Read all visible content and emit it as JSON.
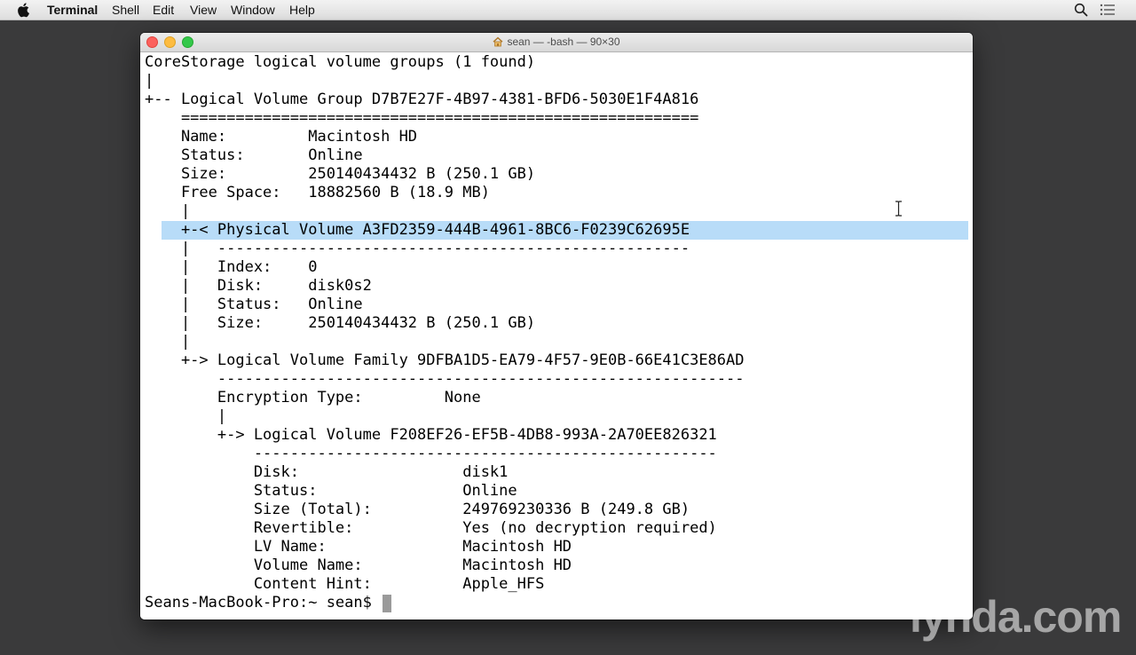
{
  "menubar": {
    "app_name": "Terminal",
    "items": [
      "Shell",
      "Edit",
      "View",
      "Window",
      "Help"
    ],
    "right_icons": [
      "spotlight-search-icon",
      "notification-center-icon"
    ]
  },
  "window": {
    "title": "sean — -bash — 90×30",
    "title_icon": "home-icon"
  },
  "terminal": {
    "lines": [
      "CoreStorage logical volume groups (1 found)",
      "|",
      "+-- Logical Volume Group D7B7E27F-4B97-4381-BFD6-5030E1F4A816",
      "    =========================================================",
      "    Name:         Macintosh HD",
      "    Status:       Online",
      "    Size:         250140434432 B (250.1 GB)",
      "    Free Space:   18882560 B (18.9 MB)",
      "    |",
      "    +-< Physical Volume A3FD2359-444B-4961-8BC6-F0239C62695E",
      "    |   ----------------------------------------------------",
      "    |   Index:    0",
      "    |   Disk:     disk0s2",
      "    |   Status:   Online",
      "    |   Size:     250140434432 B (250.1 GB)",
      "    |",
      "    +-> Logical Volume Family 9DFBA1D5-EA79-4F57-9E0B-66E41C3E86AD",
      "        ----------------------------------------------------------",
      "        Encryption Type:         None",
      "        |",
      "        +-> Logical Volume F208EF26-EF5B-4DB8-993A-2A70EE826321",
      "            ---------------------------------------------------",
      "            Disk:                  disk1",
      "            Status:                Online",
      "            Size (Total):          249769230336 B (249.8 GB)",
      "            Revertible:            Yes (no decryption required)",
      "            LV Name:               Macintosh HD",
      "            Volume Name:           Macintosh HD",
      "            Content Hint:          Apple_HFS",
      "Seans-MacBook-Pro:~ sean$ "
    ],
    "selected_line_index": 9,
    "selection_color": "#b8dcf8"
  },
  "watermark": {
    "text": "lynda.com"
  },
  "colors": {
    "desktop": "#3a3a3b",
    "terminal_bg": "#ffffff",
    "terminal_fg": "#000000",
    "close": "#fc615d",
    "minimize": "#fdbc40",
    "zoom": "#34c84a"
  }
}
